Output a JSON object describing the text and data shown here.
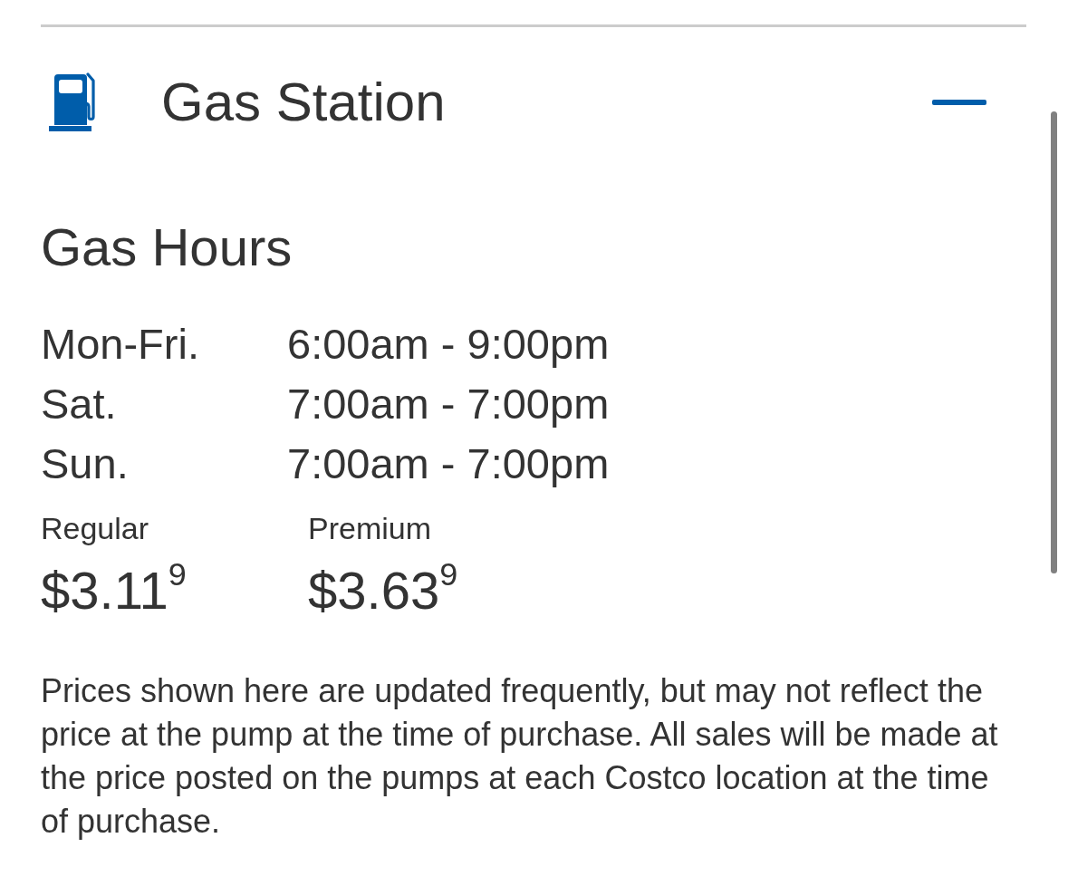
{
  "section": {
    "title": "Gas Station",
    "expanded": true
  },
  "hours": {
    "heading": "Gas Hours",
    "rows": [
      {
        "days": "Mon-Fri.",
        "time": "6:00am - 9:00pm"
      },
      {
        "days": "Sat.",
        "time": "7:00am - 7:00pm"
      },
      {
        "days": "Sun.",
        "time": "7:00am - 7:00pm"
      }
    ]
  },
  "prices": [
    {
      "label": "Regular",
      "price": "$3.11$^{9}$"
    },
    {
      "label": "Premium",
      "price": "$3.63$^{9}$"
    }
  ],
  "disclaimer": "Prices shown here are updated frequently, but may not reflect the price at the pump at the time of purchase. All sales will be made at the price posted on the pumps at each Costco location at the time of purchase."
}
